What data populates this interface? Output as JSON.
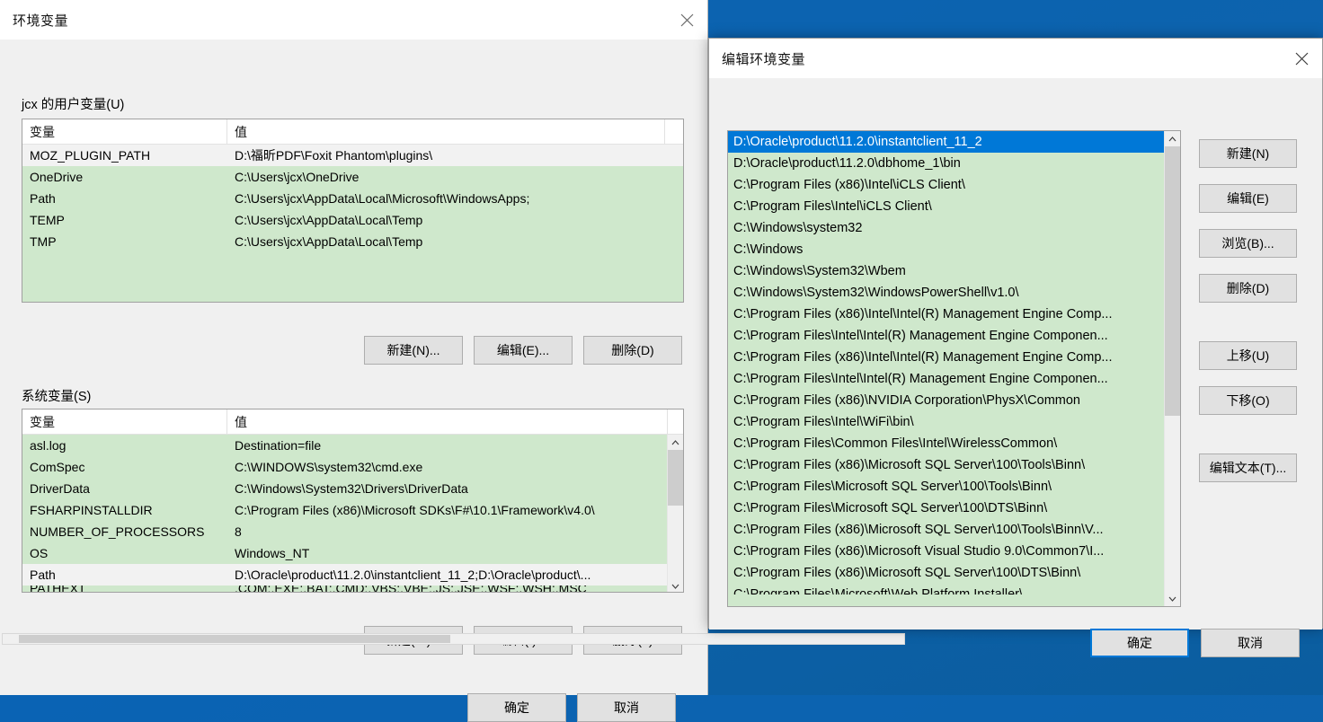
{
  "main_dialog": {
    "title": "环境变量",
    "close_icon": "close-icon",
    "user_group": {
      "label": "jcx 的用户变量(U)",
      "columns": [
        "变量",
        "值"
      ],
      "rows": [
        {
          "name": "MOZ_PLUGIN_PATH",
          "value": "D:\\福昕PDF\\Foxit Phantom\\plugins\\",
          "selected": true
        },
        {
          "name": "OneDrive",
          "value": "C:\\Users\\jcx\\OneDrive",
          "selected": false
        },
        {
          "name": "Path",
          "value": "C:\\Users\\jcx\\AppData\\Local\\Microsoft\\WindowsApps;",
          "selected": false
        },
        {
          "name": "TEMP",
          "value": "C:\\Users\\jcx\\AppData\\Local\\Temp",
          "selected": false
        },
        {
          "name": "TMP",
          "value": "C:\\Users\\jcx\\AppData\\Local\\Temp",
          "selected": false
        }
      ],
      "buttons": {
        "new": "新建(N)...",
        "edit": "编辑(E)...",
        "delete": "删除(D)"
      }
    },
    "system_group": {
      "label": "系统变量(S)",
      "columns": [
        "变量",
        "值"
      ],
      "rows": [
        {
          "name": "asl.log",
          "value": "Destination=file"
        },
        {
          "name": "ComSpec",
          "value": "C:\\WINDOWS\\system32\\cmd.exe"
        },
        {
          "name": "DriverData",
          "value": "C:\\Windows\\System32\\Drivers\\DriverData"
        },
        {
          "name": "FSHARPINSTALLDIR",
          "value": "C:\\Program Files (x86)\\Microsoft SDKs\\F#\\10.1\\Framework\\v4.0\\"
        },
        {
          "name": "NUMBER_OF_PROCESSORS",
          "value": "8"
        },
        {
          "name": "OS",
          "value": "Windows_NT"
        },
        {
          "name": "Path",
          "value": "D:\\Oracle\\product\\11.2.0\\instantclient_11_2;D:\\Oracle\\product\\..."
        },
        {
          "name": "PATHEXT",
          "value": ".COM;.EXE;.BAT;.CMD;.VBS;.VBE;.JS;.JSE;.WSF;.WSH;.MSC"
        }
      ],
      "buttons": {
        "new": "新建(W)...",
        "edit": "编辑(I)...",
        "delete": "删除(L)"
      }
    },
    "footer": {
      "ok": "确定",
      "cancel": "取消"
    }
  },
  "edit_dialog": {
    "title": "编辑环境变量",
    "close_icon": "close-icon",
    "paths": [
      {
        "value": "D:\\Oracle\\product\\11.2.0\\instantclient_11_2",
        "selected": true
      },
      {
        "value": "D:\\Oracle\\product\\11.2.0\\dbhome_1\\bin",
        "selected": false
      },
      {
        "value": "C:\\Program Files (x86)\\Intel\\iCLS Client\\",
        "selected": false
      },
      {
        "value": "C:\\Program Files\\Intel\\iCLS Client\\",
        "selected": false
      },
      {
        "value": "C:\\Windows\\system32",
        "selected": false
      },
      {
        "value": "C:\\Windows",
        "selected": false
      },
      {
        "value": "C:\\Windows\\System32\\Wbem",
        "selected": false
      },
      {
        "value": "C:\\Windows\\System32\\WindowsPowerShell\\v1.0\\",
        "selected": false
      },
      {
        "value": "C:\\Program Files (x86)\\Intel\\Intel(R) Management Engine Comp...",
        "selected": false
      },
      {
        "value": "C:\\Program Files\\Intel\\Intel(R) Management Engine Componen...",
        "selected": false
      },
      {
        "value": "C:\\Program Files (x86)\\Intel\\Intel(R) Management Engine Comp...",
        "selected": false
      },
      {
        "value": "C:\\Program Files\\Intel\\Intel(R) Management Engine Componen...",
        "selected": false
      },
      {
        "value": "C:\\Program Files (x86)\\NVIDIA Corporation\\PhysX\\Common",
        "selected": false
      },
      {
        "value": "C:\\Program Files\\Intel\\WiFi\\bin\\",
        "selected": false
      },
      {
        "value": "C:\\Program Files\\Common Files\\Intel\\WirelessCommon\\",
        "selected": false
      },
      {
        "value": "C:\\Program Files (x86)\\Microsoft SQL Server\\100\\Tools\\Binn\\",
        "selected": false
      },
      {
        "value": "C:\\Program Files\\Microsoft SQL Server\\100\\Tools\\Binn\\",
        "selected": false
      },
      {
        "value": "C:\\Program Files\\Microsoft SQL Server\\100\\DTS\\Binn\\",
        "selected": false
      },
      {
        "value": "C:\\Program Files (x86)\\Microsoft SQL Server\\100\\Tools\\Binn\\V...",
        "selected": false
      },
      {
        "value": "C:\\Program Files (x86)\\Microsoft Visual Studio 9.0\\Common7\\I...",
        "selected": false
      },
      {
        "value": "C:\\Program Files (x86)\\Microsoft SQL Server\\100\\DTS\\Binn\\",
        "selected": false
      },
      {
        "value": "C:\\Program Files\\Microsoft\\Web Platform Installer\\",
        "selected": false
      }
    ],
    "side_buttons": {
      "new": "新建(N)",
      "edit": "编辑(E)",
      "browse": "浏览(B)...",
      "delete": "删除(D)",
      "move_up": "上移(U)",
      "move_down": "下移(O)",
      "edit_text": "编辑文本(T)..."
    },
    "footer": {
      "ok": "确定",
      "cancel": "取消"
    }
  },
  "colors": {
    "desktop": "#0b5ea8",
    "dialog_face": "#f0f0f0",
    "list_green": "#cfe8cc",
    "selection_blue": "#0078d7",
    "accent_border": "#0078d7"
  }
}
